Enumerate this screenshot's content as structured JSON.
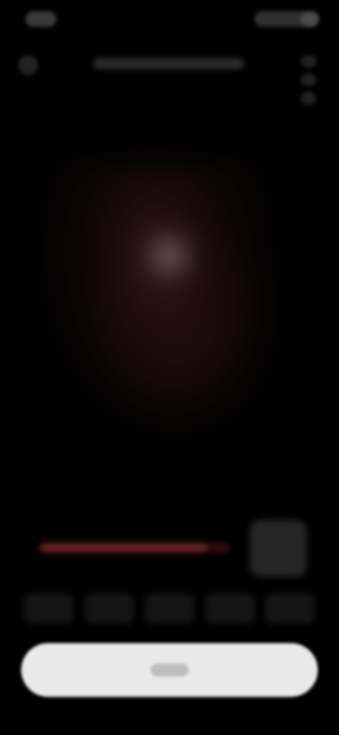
{
  "status_bar": {
    "time": "",
    "indicators": ""
  },
  "top_bar": {
    "title": ""
  },
  "side_tools": [
    "",
    "",
    ""
  ],
  "video": {
    "progress": 0.88
  },
  "tabs": [
    "",
    "",
    "",
    "",
    ""
  ],
  "cta": {
    "label": ""
  }
}
